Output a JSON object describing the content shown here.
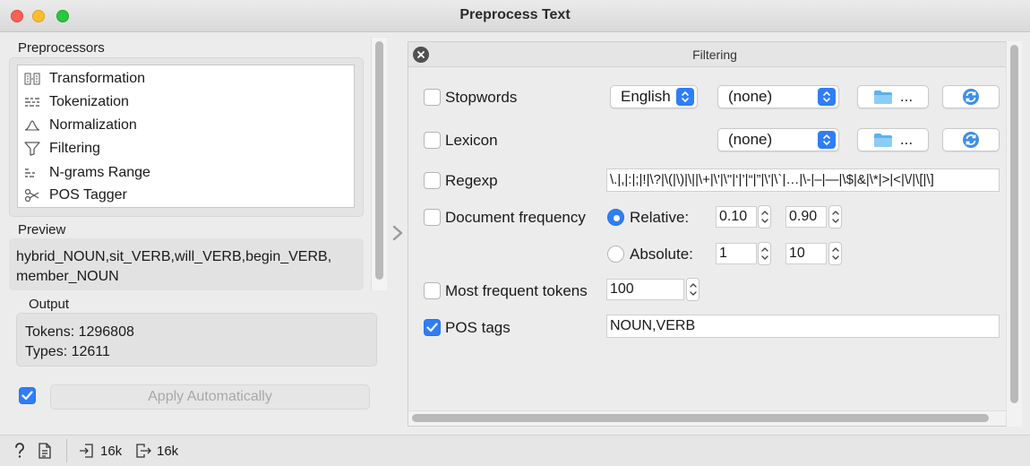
{
  "window": {
    "title": "Preprocess Text"
  },
  "left": {
    "preprocessors_label": "Preprocessors",
    "preprocessors": [
      {
        "label": "Transformation",
        "icon": "transformation-icon"
      },
      {
        "label": "Tokenization",
        "icon": "tokenization-icon"
      },
      {
        "label": "Normalization",
        "icon": "normalization-icon"
      },
      {
        "label": "Filtering",
        "icon": "filter-icon"
      },
      {
        "label": "N-grams Range",
        "icon": "ngrams-icon"
      },
      {
        "label": "POS Tagger",
        "icon": "pos-tagger-icon"
      }
    ],
    "preview_label": "Preview",
    "preview_lines": [
      "hybrid_NOUN,sit_VERB,will_VERB,begin_VERB,",
      "member_NOUN"
    ],
    "output_label": "Output",
    "output_tokens": "Tokens: 1296808",
    "output_types": "Types: 12611",
    "apply_checked": true,
    "apply_label": "Apply Automatically"
  },
  "filtering": {
    "title": "Filtering",
    "stopwords": {
      "label": "Stopwords",
      "checked": false,
      "language": "English",
      "file": "(none)",
      "browse": "..."
    },
    "lexicon": {
      "label": "Lexicon",
      "checked": false,
      "file": "(none)",
      "browse": "..."
    },
    "regexp": {
      "label": "Regexp",
      "checked": false,
      "value": "\\.|,|:|;|!|\\?|\\(|\\)|\\||\\+|\\'|\\\"|‘|’|“|”|\\'|\\`|…|\\-|–|—|\\$|&|\\*|>|<|\\/|\\[|\\]"
    },
    "docfreq": {
      "label": "Document frequency",
      "checked": false,
      "relative_label": "Relative:",
      "relative_selected": true,
      "rel_min": "0.10",
      "rel_max": "0.90",
      "absolute_label": "Absolute:",
      "abs_min": "1",
      "abs_max": "10"
    },
    "most_frequent": {
      "label": "Most frequent tokens",
      "checked": false,
      "value": "100"
    },
    "pos_tags": {
      "label": "POS tags",
      "checked": true,
      "value": "NOUN,VERB"
    }
  },
  "status": {
    "input_count": "16k",
    "output_count": "16k"
  },
  "colors": {
    "accent": "#2f7ef6",
    "close": "#fe5f57",
    "minimize": "#febc2e",
    "maximize": "#28c840"
  }
}
